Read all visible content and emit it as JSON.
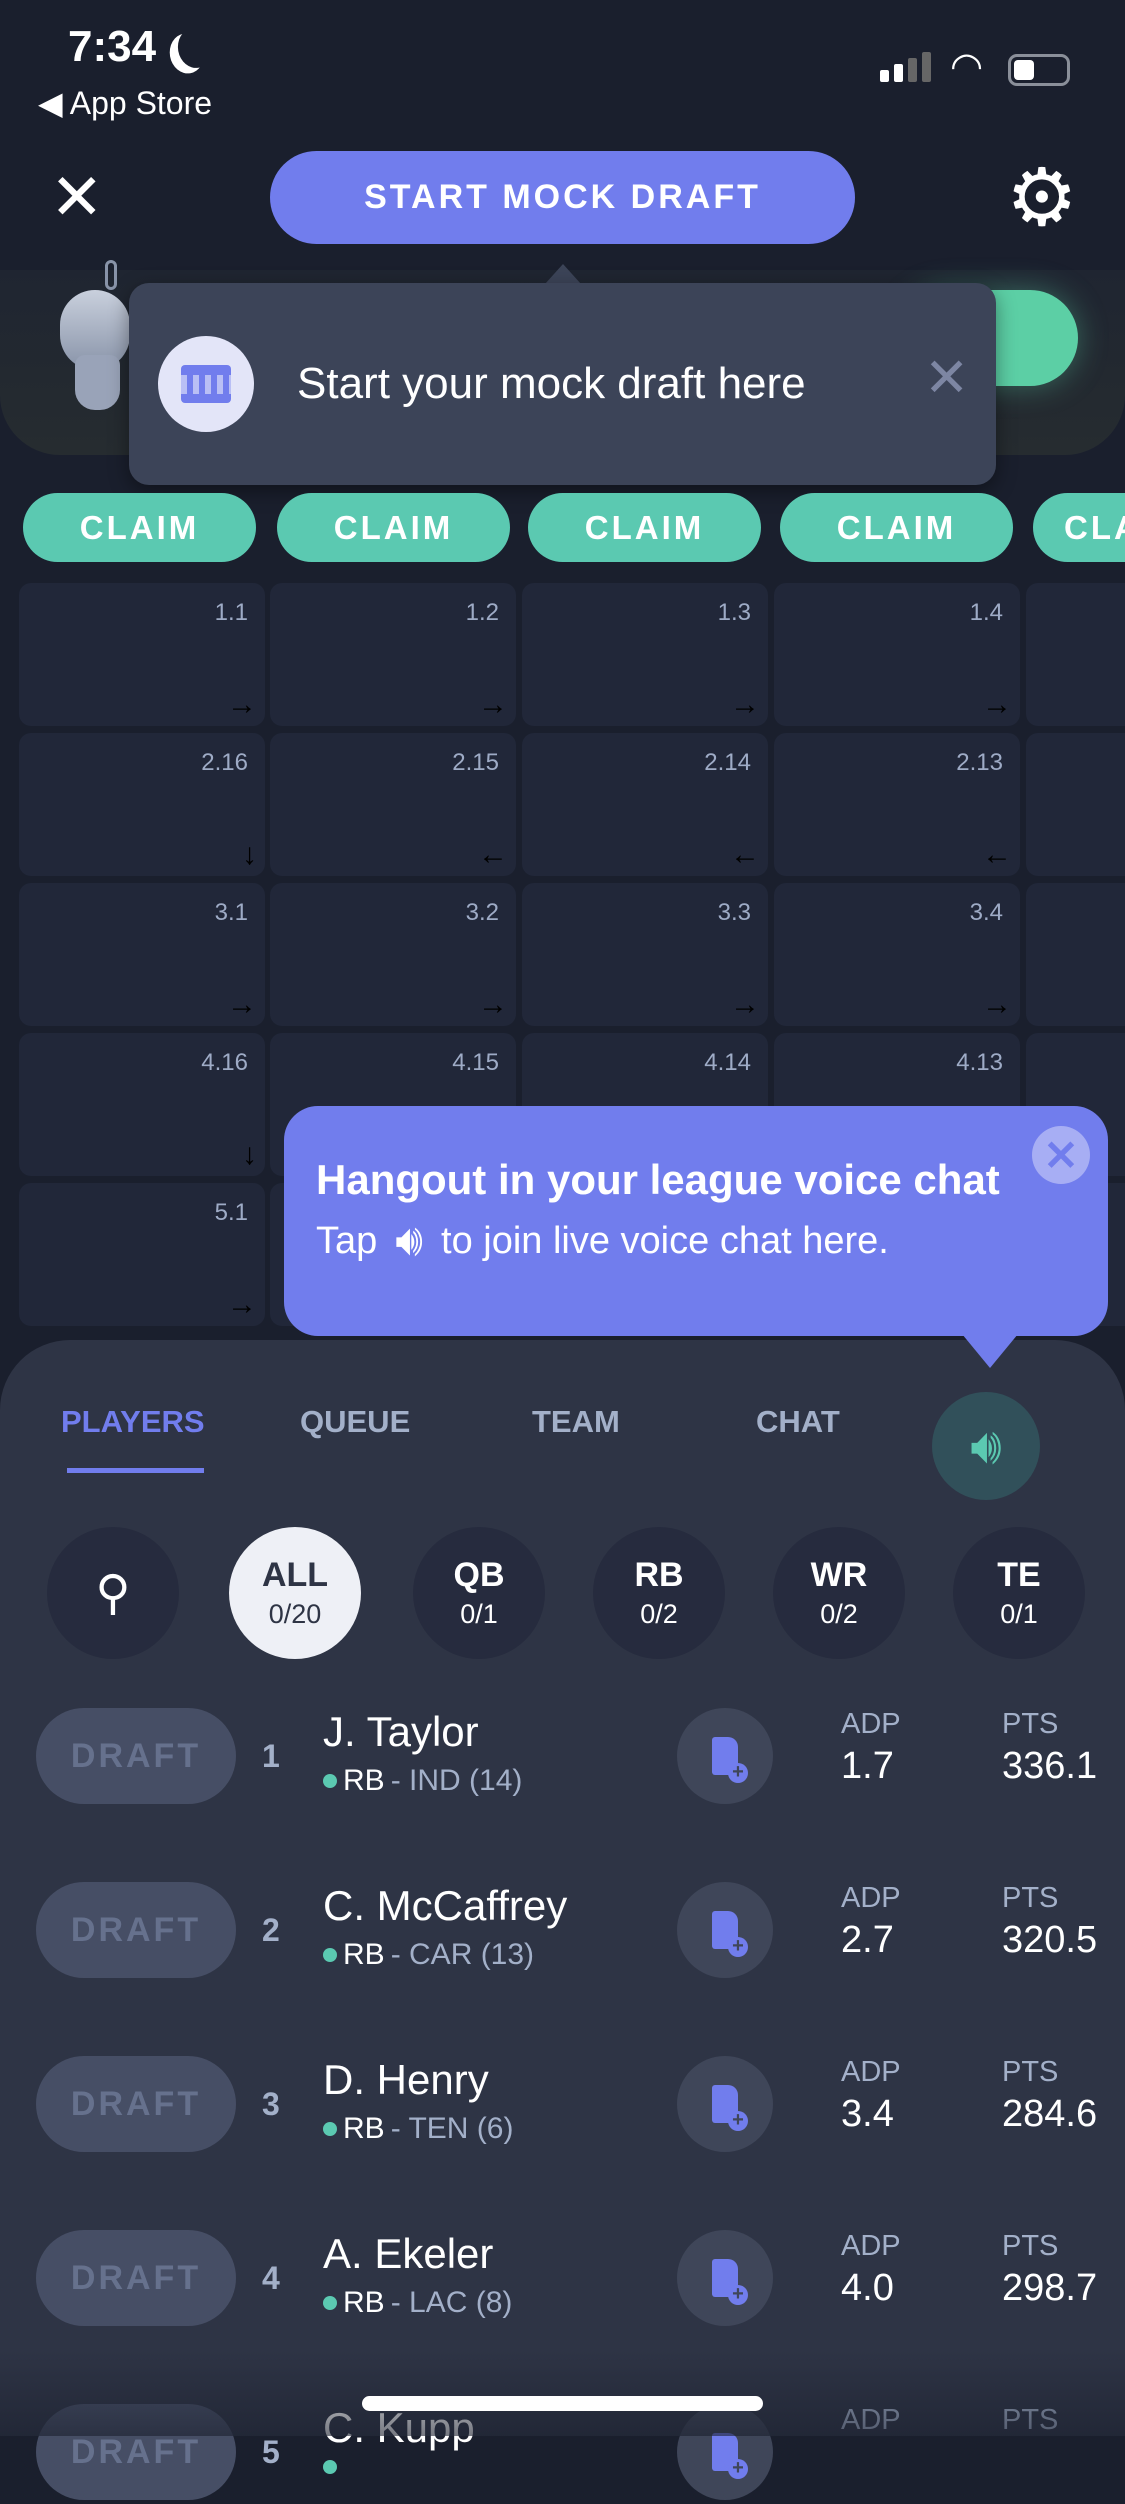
{
  "status_bar": {
    "time": "7:34",
    "back_label": "◀ App Store"
  },
  "header": {
    "start_label": "START MOCK DRAFT"
  },
  "tooltip_mock": {
    "text": "Start your mock draft here"
  },
  "claim_buttons": [
    "CLAIM",
    "CLAIM",
    "CLAIM",
    "CLAIM",
    "CLAIM"
  ],
  "board": {
    "rows": [
      {
        "picks": [
          {
            "label": "1.1",
            "arrow": "→"
          },
          {
            "label": "1.2",
            "arrow": "→"
          },
          {
            "label": "1.3",
            "arrow": "→"
          },
          {
            "label": "1.4",
            "arrow": "→"
          },
          {
            "label": "",
            "arrow": ""
          }
        ]
      },
      {
        "picks": [
          {
            "label": "2.16",
            "arrow": "↓"
          },
          {
            "label": "2.15",
            "arrow": "←"
          },
          {
            "label": "2.14",
            "arrow": "←"
          },
          {
            "label": "2.13",
            "arrow": "←"
          },
          {
            "label": "",
            "arrow": ""
          }
        ]
      },
      {
        "picks": [
          {
            "label": "3.1",
            "arrow": "→"
          },
          {
            "label": "3.2",
            "arrow": "→"
          },
          {
            "label": "3.3",
            "arrow": "→"
          },
          {
            "label": "3.4",
            "arrow": "→"
          },
          {
            "label": "",
            "arrow": ""
          }
        ]
      },
      {
        "picks": [
          {
            "label": "4.16",
            "arrow": "↓"
          },
          {
            "label": "4.15",
            "arrow": ""
          },
          {
            "label": "4.14",
            "arrow": ""
          },
          {
            "label": "4.13",
            "arrow": ""
          },
          {
            "label": "",
            "arrow": ""
          }
        ]
      },
      {
        "picks": [
          {
            "label": "5.1",
            "arrow": "→"
          },
          {
            "label": "",
            "arrow": ""
          },
          {
            "label": "",
            "arrow": ""
          },
          {
            "label": "",
            "arrow": ""
          },
          {
            "label": "",
            "arrow": ""
          }
        ]
      }
    ]
  },
  "tooltip_voice": {
    "title": "Hangout in your league voice chat",
    "tap": "Tap",
    "body": "to join live voice chat here."
  },
  "tabs": [
    {
      "label": "PLAYERS",
      "active": true
    },
    {
      "label": "QUEUE"
    },
    {
      "label": "TEAM"
    },
    {
      "label": "CHAT"
    }
  ],
  "filters": [
    {
      "name": "ALL",
      "count": "0/20",
      "selected": true
    },
    {
      "name": "QB",
      "count": "0/1"
    },
    {
      "name": "RB",
      "count": "0/2"
    },
    {
      "name": "WR",
      "count": "0/2"
    },
    {
      "name": "TE",
      "count": "0/1"
    }
  ],
  "players": {
    "draft_label": "DRAFT",
    "adp_label": "ADP",
    "pts_label": "PTS",
    "rows": [
      {
        "rank": "1",
        "name": "J. Taylor",
        "pos": "RB",
        "team": "- IND (14)",
        "adp": "1.7",
        "pts": "336.1"
      },
      {
        "rank": "2",
        "name": "C. McCaffrey",
        "pos": "RB",
        "team": "- CAR (13)",
        "adp": "2.7",
        "pts": "320.5"
      },
      {
        "rank": "3",
        "name": "D. Henry",
        "pos": "RB",
        "team": "- TEN (6)",
        "adp": "3.4",
        "pts": "284.6"
      },
      {
        "rank": "4",
        "name": "A. Ekeler",
        "pos": "RB",
        "team": "- LAC (8)",
        "adp": "4.0",
        "pts": "298.7"
      },
      {
        "rank": "5",
        "name": "C. Kupp",
        "pos": "",
        "team": "",
        "adp": "",
        "pts": ""
      }
    ]
  },
  "colors": {
    "accent": "#717ded",
    "claim": "#5bc9b1",
    "background": "#1a1f2d",
    "panel": "#2e3445"
  }
}
